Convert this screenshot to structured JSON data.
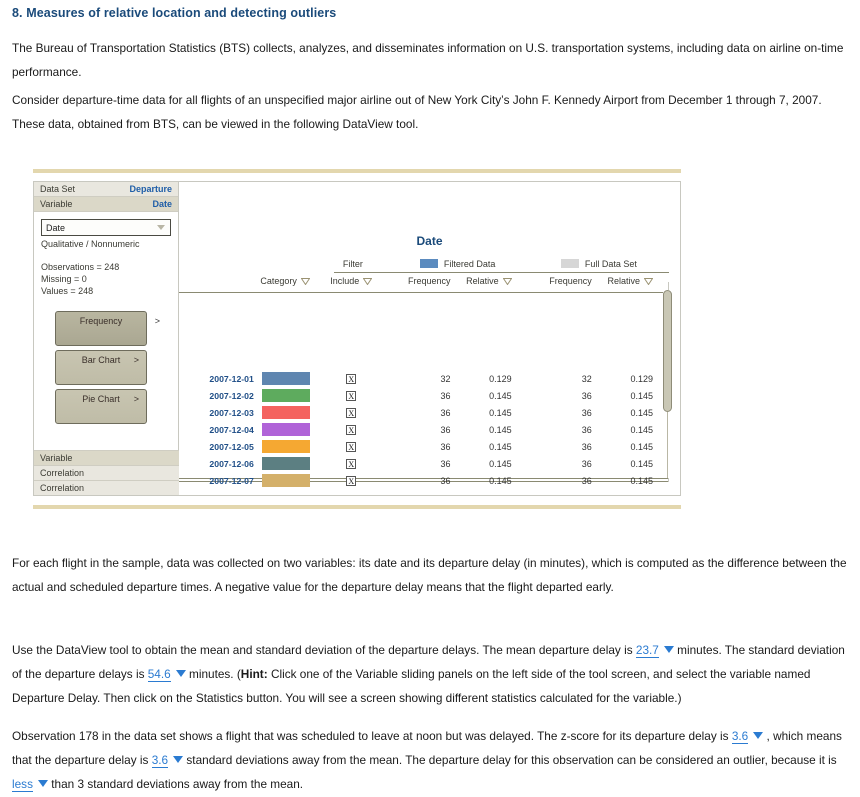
{
  "question": {
    "number_title": "8. Measures of relative location and detecting outliers",
    "para1": "The Bureau of Transportation Statistics (BTS) collects, analyzes, and disseminates information on U.S. transportation systems, including data on airline on-time performance.",
    "para2": "Consider departure-time data for all flights of an unspecified major airline out of New York City’s John F. Kennedy Airport from December 1 through 7, 2007. These data, obtained from BTS, can be viewed in the following DataView tool.",
    "para3": "For each flight in the sample, data was collected on two variables: its date and its departure delay (in minutes), which is computed as the difference between the actual and scheduled departure times. A negative value for the departure delay means that the flight departed early.",
    "para4_a": "Use the DataView tool to obtain the mean and standard deviation of the departure delays. The mean departure delay is",
    "para4_b": "minutes. The standard deviation of the departure delays is",
    "para4_c": "minutes. (",
    "para4_hint_label": "Hint:",
    "para4_d": " Click one of the Variable sliding panels on the left side of the tool screen, and select the variable named Departure Delay. Then click on the Statistics button. You will see a screen showing different statistics calculated for the variable.)",
    "para5_a": "Observation 178 in the data set shows a flight that was scheduled to leave at noon but was delayed. The z-score for its departure delay is",
    "para5_b": ", which means that the departure delay is",
    "para5_c": "standard deviations away from the mean. The departure delay for this observation can be considered an outlier, because it is",
    "para5_d": "than 3 standard deviations away from the mean."
  },
  "dropdowns": {
    "mean": "23.7",
    "sd": "54.6",
    "zscore": "3.6",
    "sd_away": "3.6",
    "less_more": "less"
  },
  "tool": {
    "left_panel": {
      "dataset_label": "Data Set",
      "dataset_value": "Departure",
      "variable_label": "Variable",
      "variable_value": "Date",
      "select_value": "Date",
      "var_type": "Qualitative / Nonnumeric",
      "observations": "Observations = 248",
      "missing": "Missing = 0",
      "values": "Values = 248",
      "buttons": [
        {
          "label": "Frequency",
          "chevron": ">"
        },
        {
          "label": "Bar Chart",
          "chevron": ">"
        },
        {
          "label": "Pie Chart",
          "chevron": ">"
        }
      ],
      "bottom_bars": [
        {
          "label": "Variable"
        },
        {
          "label": "Correlation"
        },
        {
          "label": "Correlation"
        }
      ]
    },
    "data_panel": {
      "title": "Date",
      "group_headers": {
        "filter": "Filter",
        "filtered_data": "Filtered Data",
        "full_data_set": "Full Data Set",
        "filtered_swatch_color": "#5b8bbf",
        "full_swatch_color": "#d6d6d6"
      },
      "columns": {
        "category": "Category",
        "include": "Include",
        "filtered_frequency": "Frequency",
        "filtered_relative": "Relative",
        "full_frequency": "Frequency",
        "full_relative": "Relative"
      },
      "include_mark": "X",
      "rows": [
        {
          "category": "2007-12-01",
          "color": "#5f86b0",
          "include": true,
          "f_freq": "32",
          "f_rel": "0.129",
          "t_freq": "32",
          "t_rel": "0.129"
        },
        {
          "category": "2007-12-02",
          "color": "#5eab5e",
          "include": true,
          "f_freq": "36",
          "f_rel": "0.145",
          "t_freq": "36",
          "t_rel": "0.145"
        },
        {
          "category": "2007-12-03",
          "color": "#f4635f",
          "include": true,
          "f_freq": "36",
          "f_rel": "0.145",
          "t_freq": "36",
          "t_rel": "0.145"
        },
        {
          "category": "2007-12-04",
          "color": "#b063d8",
          "include": true,
          "f_freq": "36",
          "f_rel": "0.145",
          "t_freq": "36",
          "t_rel": "0.145"
        },
        {
          "category": "2007-12-05",
          "color": "#f5a832",
          "include": true,
          "f_freq": "36",
          "f_rel": "0.145",
          "t_freq": "36",
          "t_rel": "0.145"
        },
        {
          "category": "2007-12-06",
          "color": "#5c7f82",
          "include": true,
          "f_freq": "36",
          "f_rel": "0.145",
          "t_freq": "36",
          "t_rel": "0.145"
        },
        {
          "category": "2007-12-07",
          "color": "#d4b06a",
          "include": true,
          "f_freq": "36",
          "f_rel": "0.145",
          "t_freq": "36",
          "t_rel": "0.145"
        }
      ]
    }
  },
  "colors": {
    "heading_blue": "#1a4a7a",
    "link_blue": "#2b7bd1",
    "gold_rule": "#e3d7ae"
  }
}
